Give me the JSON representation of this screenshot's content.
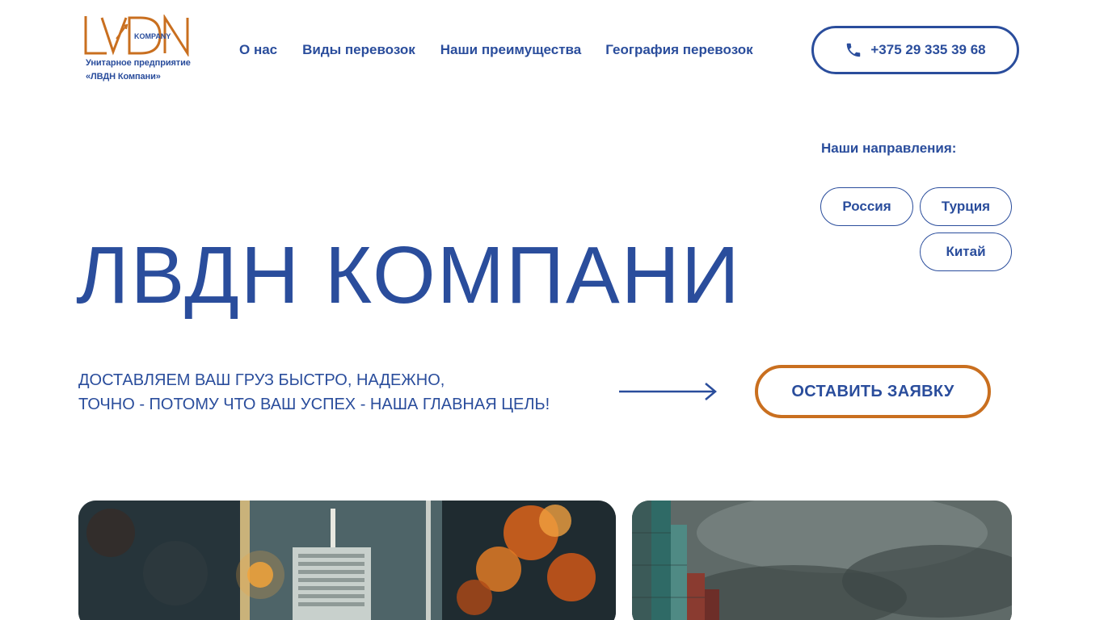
{
  "logo": {
    "mark_text": "LVDN",
    "mark_sub": "KOMPANY",
    "line1": "Унитарное предприятие",
    "line2": "«ЛВДН Компани»"
  },
  "nav": {
    "items": [
      {
        "label": "О нас"
      },
      {
        "label": "Виды перевозок"
      },
      {
        "label": "Наши преимущества"
      },
      {
        "label": "География перевозок"
      }
    ]
  },
  "phone": {
    "icon": "phone-icon",
    "number": "+375 29 335 39 68"
  },
  "directions": {
    "title": "Наши направления:",
    "items": [
      {
        "label": "Россия"
      },
      {
        "label": "Турция"
      },
      {
        "label": "Китай"
      }
    ]
  },
  "hero": {
    "title": "ЛВДН КОМПАНИ",
    "tagline_line1": "ДОСТАВЛЯЕМ ВАШ ГРУЗ БЫСТРО, НАДЕЖНО,",
    "tagline_line2": "ТОЧНО - ПОТОМУ ЧТО ВАШ УСПЕХ - НАША ГЛАВНАЯ ЦЕЛЬ!",
    "cta_label": "ОСТАВИТЬ ЗАЯВКУ"
  },
  "colors": {
    "primary": "#2a4d9c",
    "accent": "#c96f1f",
    "background": "#ffffff"
  },
  "images": [
    {
      "subject": "truck on autumn road, aerial view"
    },
    {
      "subject": "shipping containers at port under stormy sky"
    }
  ]
}
